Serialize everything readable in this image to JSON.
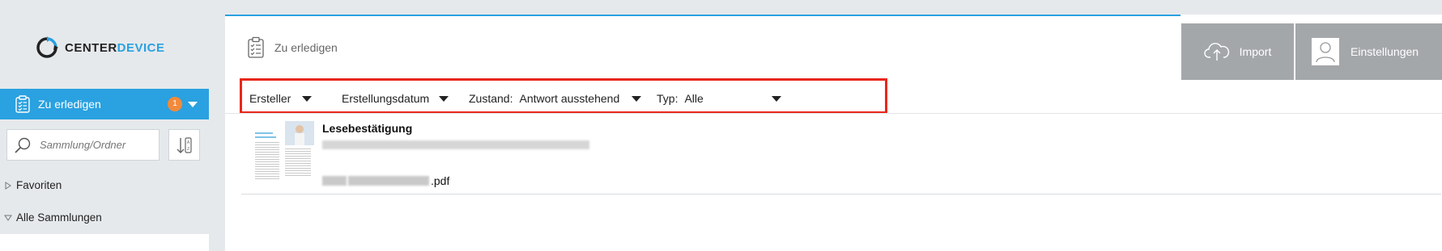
{
  "brand": {
    "name_part1": "CENTER",
    "name_part2": "DEVICE",
    "accent_color": "#2aa1e0"
  },
  "sidebar": {
    "active_item": {
      "label": "Zu erledigen",
      "badge": "1",
      "icon": "clipboard-checklist-icon"
    },
    "search": {
      "placeholder": "Sammlung/Ordner"
    },
    "tree": [
      {
        "label": "Favoriten",
        "expanded": false
      },
      {
        "label": "Alle Sammlungen",
        "expanded": true
      }
    ]
  },
  "header": {
    "title": "Zu erledigen",
    "icon": "clipboard-checklist-icon"
  },
  "actions": {
    "import_label": "Import",
    "settings_label": "Einstellungen"
  },
  "filters": {
    "creator": {
      "label": "Ersteller",
      "value": ""
    },
    "created_date": {
      "label": "Erstellungsdatum",
      "value": ""
    },
    "state": {
      "label": "Zustand:",
      "value": "Antwort ausstehend"
    },
    "type": {
      "label": "Typ:",
      "value": "Alle"
    },
    "highlight_color": "#e8271a"
  },
  "documents": [
    {
      "title": "Lesebestätigung",
      "filename_suffix": ".pdf"
    }
  ]
}
